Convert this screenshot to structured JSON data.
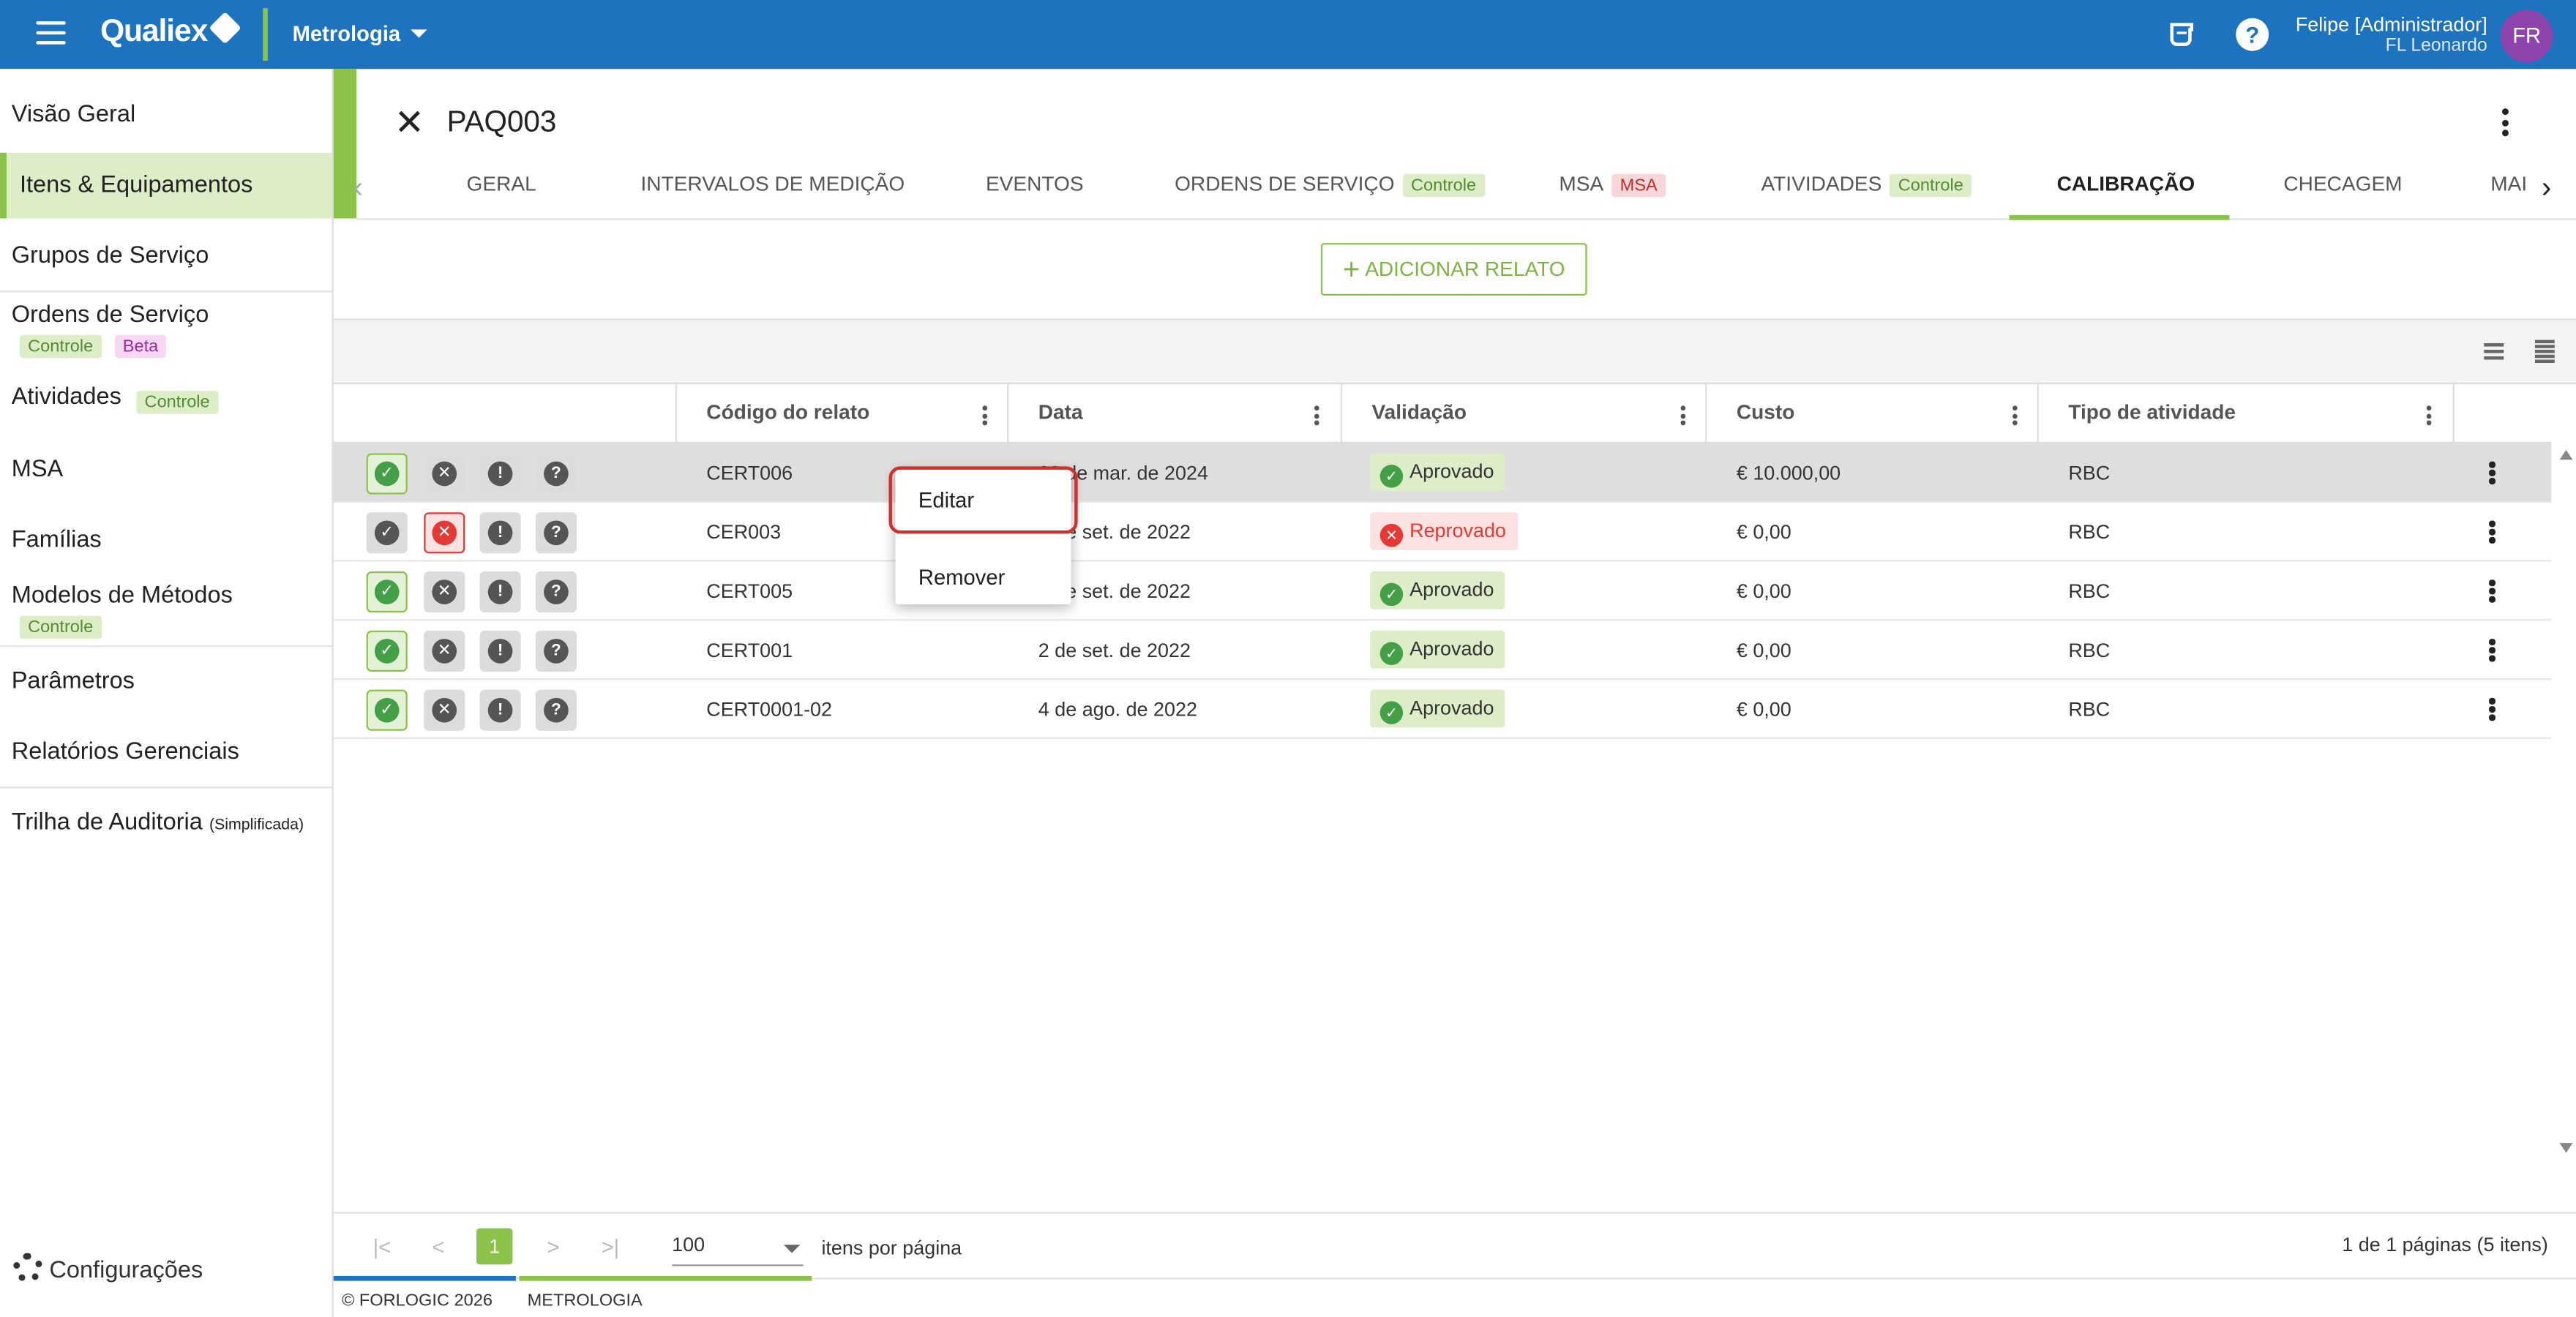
{
  "header": {
    "brand": "Qualiex",
    "module": "Metrologia",
    "user_name": "Felipe [Administrador]",
    "user_company": "FL Leonardo",
    "avatar_initials": "FR",
    "help_label": "?"
  },
  "sidebar": {
    "items": [
      {
        "label": "Visão Geral"
      },
      {
        "label": "Itens & Equipamentos"
      },
      {
        "label": "Grupos de Serviço"
      },
      {
        "label": "Ordens de Serviço",
        "chips": [
          "Controle",
          "Beta"
        ]
      },
      {
        "label": "Atividades",
        "chips": [
          "Controle"
        ]
      },
      {
        "label": "MSA"
      },
      {
        "label": "Famílias"
      },
      {
        "label": "Modelos de Métodos",
        "chips": [
          "Controle"
        ]
      },
      {
        "label": "Parâmetros"
      },
      {
        "label": "Relatórios Gerenciais"
      },
      {
        "label": "Trilha de Auditoria",
        "suffix": "(Simplificada)"
      }
    ],
    "settings": "Configurações"
  },
  "page": {
    "title": "PAQ003",
    "close_glyph": "✕",
    "tabs": [
      {
        "label": "GERAL"
      },
      {
        "label": "INTERVALOS DE MEDIÇÃO"
      },
      {
        "label": "EVENTOS"
      },
      {
        "label": "ORDENS DE SERVIÇO",
        "chip": "Controle"
      },
      {
        "label": "MSA",
        "chip": "MSA"
      },
      {
        "label": "ATIVIDADES",
        "chip": "Controle"
      },
      {
        "label": "CALIBRAÇÃO",
        "active": true
      },
      {
        "label": "CHECAGEM"
      },
      {
        "label": "MAI"
      }
    ],
    "add_button": "ADICIONAR RELATO",
    "add_icon": "+"
  },
  "table": {
    "columns": [
      "Código do relato",
      "Data",
      "Validação",
      "Custo",
      "Tipo de atividade"
    ],
    "rows": [
      {
        "code": "CERT006",
        "date": "28 de mar. de 2024",
        "status": "Aprovado",
        "cost": "€ 10.000,00",
        "type": "RBC"
      },
      {
        "code": "CER003",
        "date": "2 de set. de 2022",
        "status": "Reprovado",
        "cost": "€ 0,00",
        "type": "RBC"
      },
      {
        "code": "CERT005",
        "date": "2 de set. de 2022",
        "status": "Aprovado",
        "cost": "€ 0,00",
        "type": "RBC"
      },
      {
        "code": "CERT001",
        "date": "2 de set. de 2022",
        "status": "Aprovado",
        "cost": "€ 0,00",
        "type": "RBC"
      },
      {
        "code": "CERT0001-02",
        "date": "4 de ago. de 2022",
        "status": "Aprovado",
        "cost": "€ 0,00",
        "type": "RBC"
      }
    ]
  },
  "context_menu": {
    "edit": "Editar",
    "remove": "Remover"
  },
  "pagination": {
    "current_page": "1",
    "per_page": "100",
    "per_page_label": "itens por página",
    "info": "1 de 1 páginas (5 itens)",
    "first": "|<",
    "prev": "<",
    "next": ">",
    "last": ">|"
  },
  "footer": {
    "copyright": "© FORLOGIC 2026",
    "module": "METROLOGIA"
  },
  "colors": {
    "primary": "#1e73be",
    "accent": "#8bc34a",
    "success": "#43a047",
    "danger": "#e53935",
    "avatar": "#8e44ad"
  }
}
